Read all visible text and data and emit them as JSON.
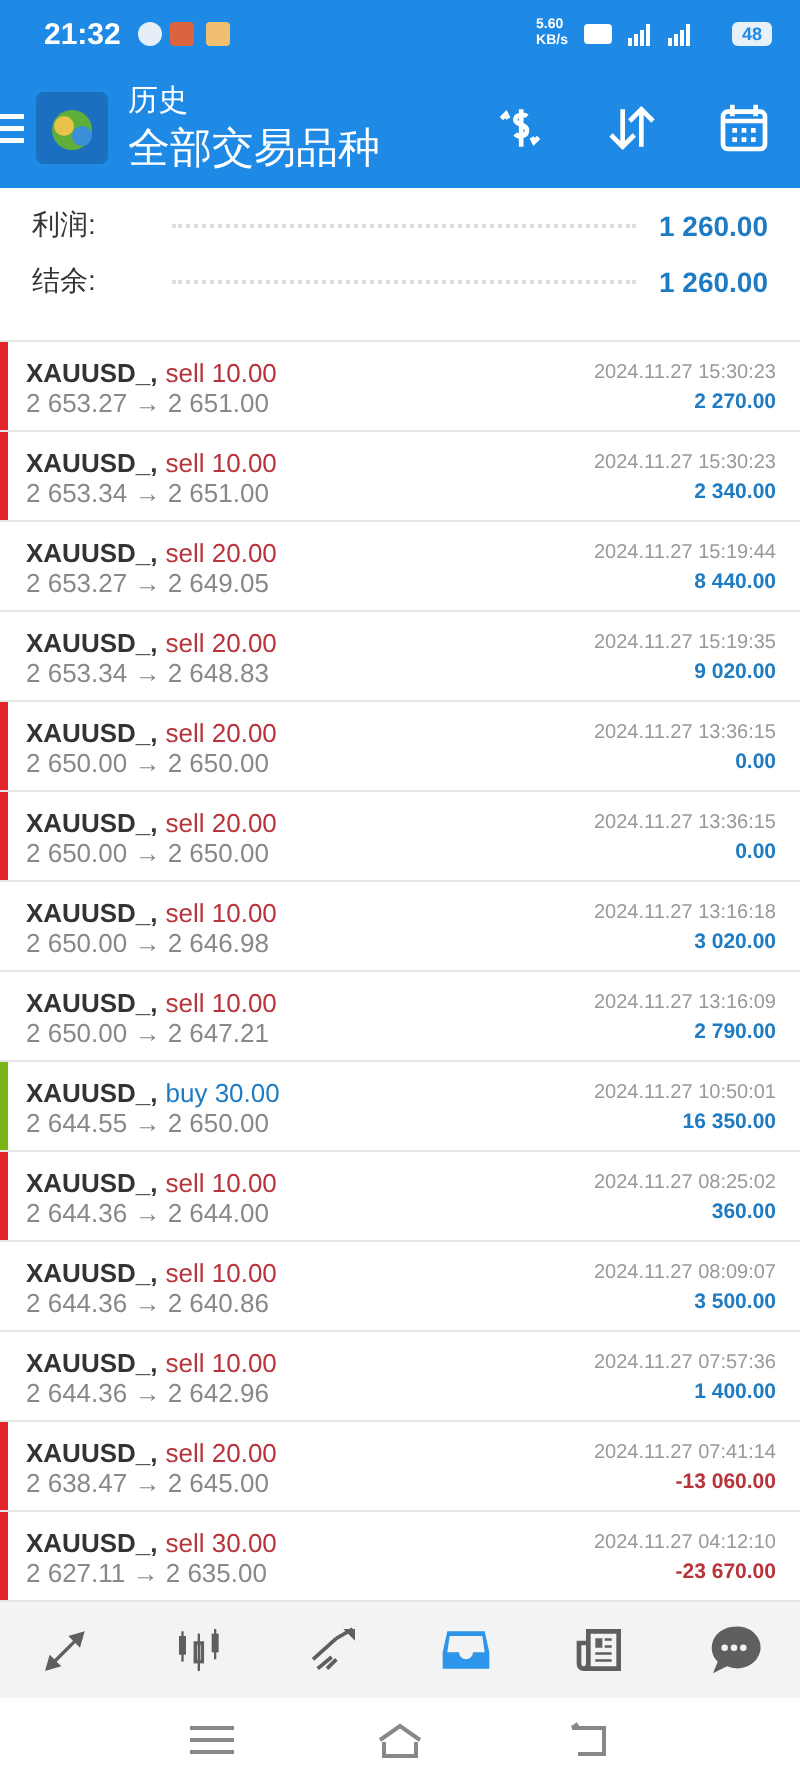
{
  "status_bar": {
    "time": "21:32",
    "speed": "5.60\nKB/s",
    "battery": "48"
  },
  "header": {
    "title": "历史",
    "subtitle": "全部交易品种"
  },
  "summary": [
    {
      "label": "利润:",
      "value": "1 260.00"
    },
    {
      "label": "结余:",
      "value": "1 260.00"
    }
  ],
  "deals": [
    {
      "symbol": "XAUUSD_,",
      "kind": "sell",
      "order": "sell 10.00",
      "prices": "2 653.27 → 2 651.00",
      "time": "2024.11.27 15:30:23",
      "profit": "2 270.00",
      "loss": false,
      "color": "#e3242b"
    },
    {
      "symbol": "XAUUSD_,",
      "kind": "sell",
      "order": "sell 10.00",
      "prices": "2 653.34 → 2 651.00",
      "time": "2024.11.27 15:30:23",
      "profit": "2 340.00",
      "loss": false,
      "color": "#e3242b"
    },
    {
      "symbol": "XAUUSD_,",
      "kind": "sell",
      "order": "sell 20.00",
      "prices": "2 653.27 → 2 649.05",
      "time": "2024.11.27 15:19:44",
      "profit": "8 440.00",
      "loss": false
    },
    {
      "symbol": "XAUUSD_,",
      "kind": "sell",
      "order": "sell 20.00",
      "prices": "2 653.34 → 2 648.83",
      "time": "2024.11.27 15:19:35",
      "profit": "9 020.00",
      "loss": false
    },
    {
      "symbol": "XAUUSD_,",
      "kind": "sell",
      "order": "sell 20.00",
      "prices": "2 650.00 → 2 650.00",
      "time": "2024.11.27 13:36:15",
      "profit": "0.00",
      "loss": false,
      "color": "#e3242b"
    },
    {
      "symbol": "XAUUSD_,",
      "kind": "sell",
      "order": "sell 20.00",
      "prices": "2 650.00 → 2 650.00",
      "time": "2024.11.27 13:36:15",
      "profit": "0.00",
      "loss": false,
      "color": "#e3242b"
    },
    {
      "symbol": "XAUUSD_,",
      "kind": "sell",
      "order": "sell 10.00",
      "prices": "2 650.00 → 2 646.98",
      "time": "2024.11.27 13:16:18",
      "profit": "3 020.00",
      "loss": false
    },
    {
      "symbol": "XAUUSD_,",
      "kind": "sell",
      "order": "sell 10.00",
      "prices": "2 650.00 → 2 647.21",
      "time": "2024.11.27 13:16:09",
      "profit": "2 790.00",
      "loss": false
    },
    {
      "symbol": "XAUUSD_,",
      "kind": "buy",
      "order": "buy 30.00",
      "prices": "2 644.55 → 2 650.00",
      "time": "2024.11.27 10:50:01",
      "profit": "16 350.00",
      "loss": false,
      "color": "#7cb518"
    },
    {
      "symbol": "XAUUSD_,",
      "kind": "sell",
      "order": "sell 10.00",
      "prices": "2 644.36 → 2 644.00",
      "time": "2024.11.27 08:25:02",
      "profit": "360.00",
      "loss": false,
      "color": "#e3242b"
    },
    {
      "symbol": "XAUUSD_,",
      "kind": "sell",
      "order": "sell 10.00",
      "prices": "2 644.36 → 2 640.86",
      "time": "2024.11.27 08:09:07",
      "profit": "3 500.00",
      "loss": false
    },
    {
      "symbol": "XAUUSD_,",
      "kind": "sell",
      "order": "sell 10.00",
      "prices": "2 644.36 → 2 642.96",
      "time": "2024.11.27 07:57:36",
      "profit": "1 400.00",
      "loss": false
    },
    {
      "symbol": "XAUUSD_,",
      "kind": "sell",
      "order": "sell 20.00",
      "prices": "2 638.47 → 2 645.00",
      "time": "2024.11.27 07:41:14",
      "profit": "-13 060.00",
      "loss": true,
      "color": "#e3242b"
    },
    {
      "symbol": "XAUUSD_,",
      "kind": "sell",
      "order": "sell 30.00",
      "prices": "2 627.11 → 2 635.00",
      "time": "2024.11.27 04:12:10",
      "profit": "-23 670.00",
      "loss": true,
      "color": "#e3242b"
    }
  ],
  "bottom_nav": [
    {
      "kind": "quotes",
      "selected": false
    },
    {
      "kind": "chart",
      "selected": false
    },
    {
      "kind": "trade",
      "selected": false
    },
    {
      "kind": "history",
      "selected": true
    },
    {
      "kind": "news",
      "selected": false
    },
    {
      "kind": "chat",
      "selected": false
    }
  ]
}
